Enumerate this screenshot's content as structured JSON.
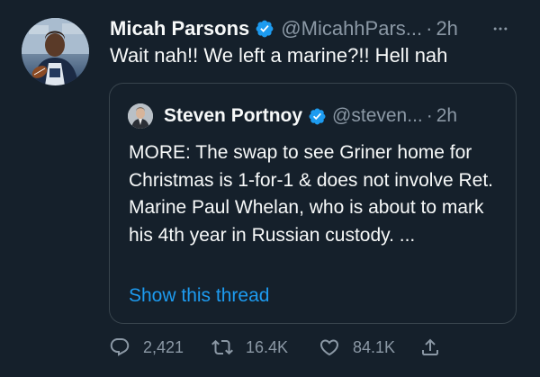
{
  "tweet": {
    "author_name": "Micah Parsons",
    "author_handle": "@MicahhPars...",
    "separator": "·",
    "time": "2h",
    "text": "Wait nah!! We left a marine?!! Hell nah"
  },
  "quoted_tweet": {
    "author_name": "Steven Portnoy",
    "author_handle": "@steven...",
    "separator": "·",
    "time": "2h",
    "text": "MORE: The swap to see Griner home for Christmas is 1-for-1 & does not involve Ret. Marine Paul Whelan, who is about to mark his 4th year in Russian custody.  ...",
    "show_thread_label": "Show this thread"
  },
  "actions": {
    "replies": "2,421",
    "retweets": "16.4K",
    "likes": "84.1K"
  },
  "icons": {
    "verified": "verified-badge-icon",
    "more": "more-horizontal-icon",
    "reply": "reply-icon",
    "retweet": "retweet-icon",
    "like": "heart-icon",
    "share": "share-icon"
  },
  "colors": {
    "background": "#15202b",
    "text_primary": "#f7f9f9",
    "text_secondary": "#8b98a5",
    "accent": "#1d9bf0",
    "border": "#38444d"
  }
}
